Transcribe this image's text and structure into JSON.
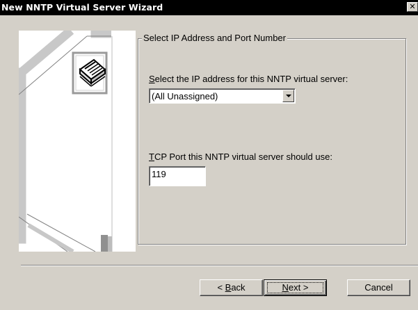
{
  "window": {
    "title": "New NNTP Virtual Server Wizard",
    "close_glyph": "✕"
  },
  "group": {
    "caption": "Select IP Address and Port Number"
  },
  "ip": {
    "label_accel": "S",
    "label_rest": "elect the IP address for this NNTP virtual server:",
    "selected": "(All Unassigned)"
  },
  "port": {
    "label_accel": "T",
    "label_rest": "CP Port this NNTP virtual server should use:",
    "value": "119"
  },
  "buttons": {
    "back_prefix": "< ",
    "back_accel": "B",
    "back_rest": "ack",
    "next_accel": "N",
    "next_rest": "ext >",
    "cancel": "Cancel"
  },
  "icons": {
    "art": "news-server-illustration",
    "newspaper": "newspaper-icon",
    "dropdown": "chevron-down-icon",
    "close": "close-icon"
  },
  "colors": {
    "titlebar": "#000000",
    "face": "#d4d0c8",
    "shadow": "#808080",
    "highlight": "#ffffff"
  }
}
